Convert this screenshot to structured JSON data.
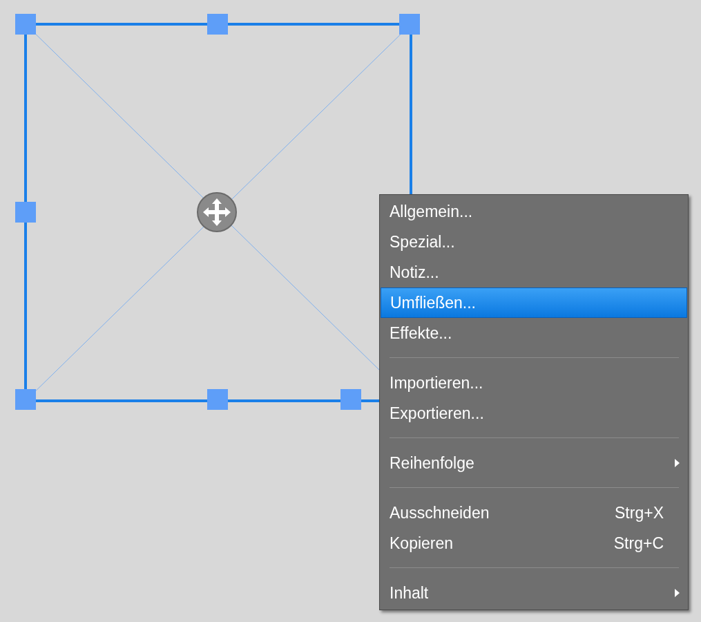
{
  "canvas": {
    "frame": {
      "selected": true
    }
  },
  "context_menu": {
    "items": [
      {
        "kind": "item",
        "label": "Allgemein...",
        "selected": false
      },
      {
        "kind": "item",
        "label": "Spezial...",
        "selected": false
      },
      {
        "kind": "item",
        "label": "Notiz...",
        "selected": false
      },
      {
        "kind": "item",
        "label": "Umfließen...",
        "selected": true
      },
      {
        "kind": "item",
        "label": "Effekte...",
        "selected": false
      },
      {
        "kind": "separator"
      },
      {
        "kind": "item",
        "label": "Importieren...",
        "selected": false
      },
      {
        "kind": "item",
        "label": "Exportieren...",
        "selected": false
      },
      {
        "kind": "separator"
      },
      {
        "kind": "submenu",
        "label": "Reihenfolge",
        "selected": false
      },
      {
        "kind": "separator"
      },
      {
        "kind": "item",
        "label": "Ausschneiden",
        "shortcut": "Strg+X",
        "selected": false
      },
      {
        "kind": "item",
        "label": "Kopieren",
        "shortcut": "Strg+C",
        "selected": false
      },
      {
        "kind": "separator"
      },
      {
        "kind": "submenu",
        "label": "Inhalt",
        "selected": false
      }
    ]
  }
}
